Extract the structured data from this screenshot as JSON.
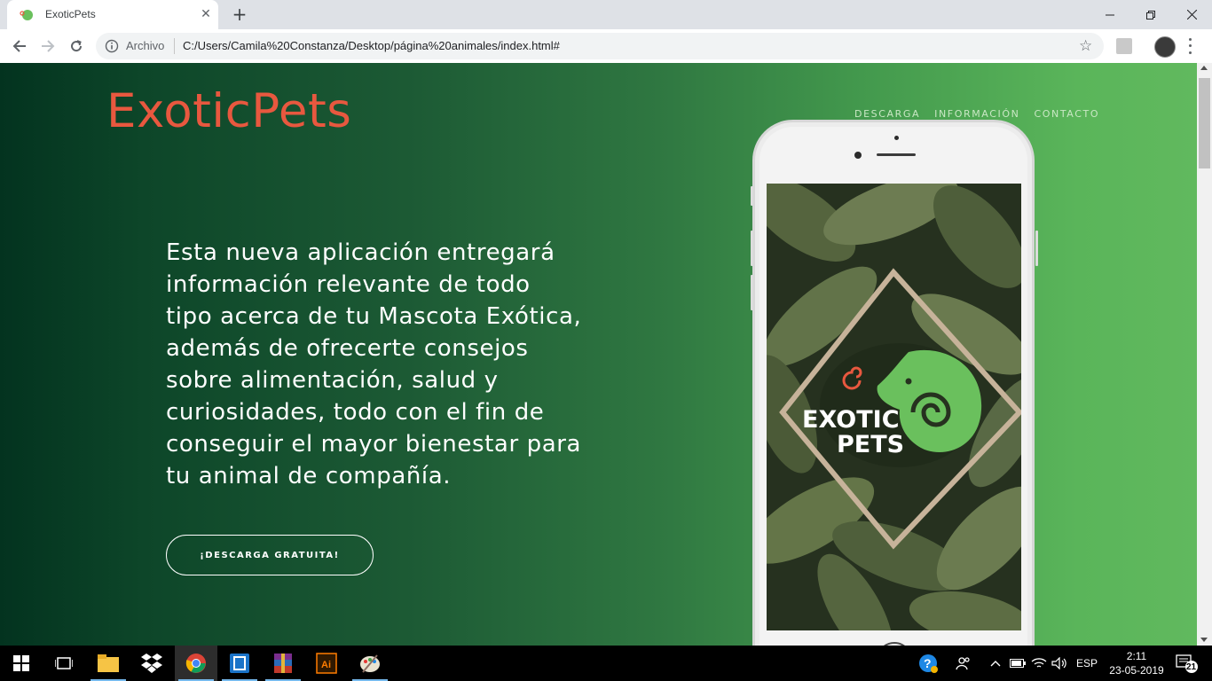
{
  "browser": {
    "tab_title": "ExoticPets",
    "address_scheme": "Archivo",
    "address_url": "C:/Users/Camila%20Constanza/Desktop/página%20animales/index.html#"
  },
  "page": {
    "logo": "ExoticPets",
    "nav": [
      "DESCARGA",
      "INFORMACIÓN",
      "CONTACTO"
    ],
    "hero_lines": [
      "Esta nueva aplicación entregará",
      "información relevante de todo",
      "tipo acerca de tu Mascota Exótica,",
      "además de ofrecerte consejos",
      "sobre alimentación, salud y",
      "curiosidades, todo con el fin de",
      "conseguir el mayor bienestar para",
      "tu animal de compañía."
    ],
    "cta_label": "¡DESCARGA GRATUITA!",
    "app_logo_line1": "EXOTIC",
    "app_logo_line2": "PETS"
  },
  "taskbar": {
    "language": "ESP",
    "time": "2:11",
    "date": "23-05-2019",
    "notifications": "21"
  },
  "colors": {
    "logo": "#e8583f",
    "gradient_left": "#03331f",
    "gradient_right": "#61b95e",
    "chameleon": "#6ac05d"
  }
}
